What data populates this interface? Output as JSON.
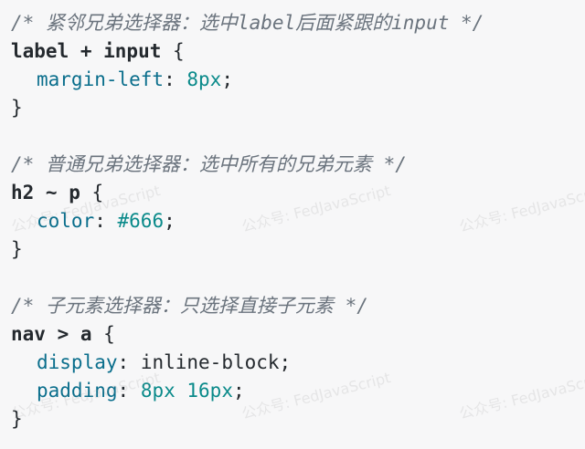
{
  "blocks": [
    {
      "comment": "/* 紧邻兄弟选择器：选中label后面紧跟的input */",
      "selector": "label + input",
      "declarations": [
        {
          "prop": "margin-left",
          "value": "8px",
          "value_type": "num"
        }
      ]
    },
    {
      "comment": "/* 普通兄弟选择器：选中所有的兄弟元素 */",
      "selector": "h2 ~ p",
      "declarations": [
        {
          "prop": "color",
          "value": "#666",
          "value_type": "num"
        }
      ]
    },
    {
      "comment": "/* 子元素选择器：只选择直接子元素 */",
      "selector": "nav > a",
      "declarations": [
        {
          "prop": "display",
          "value": "inline-block",
          "value_type": "plain"
        },
        {
          "prop": "padding",
          "value": "8px 16px",
          "value_type": "num"
        }
      ]
    }
  ],
  "syntax": {
    "open_brace": " {",
    "close_brace": "}",
    "colon": ": ",
    "semicolon": ";"
  },
  "watermark_text": "公众号: FedJavaScript",
  "colors": {
    "background": "#f7f7f8",
    "comment": "#6a737d",
    "property": "#0a6e8c",
    "number": "#0a8a8a"
  }
}
